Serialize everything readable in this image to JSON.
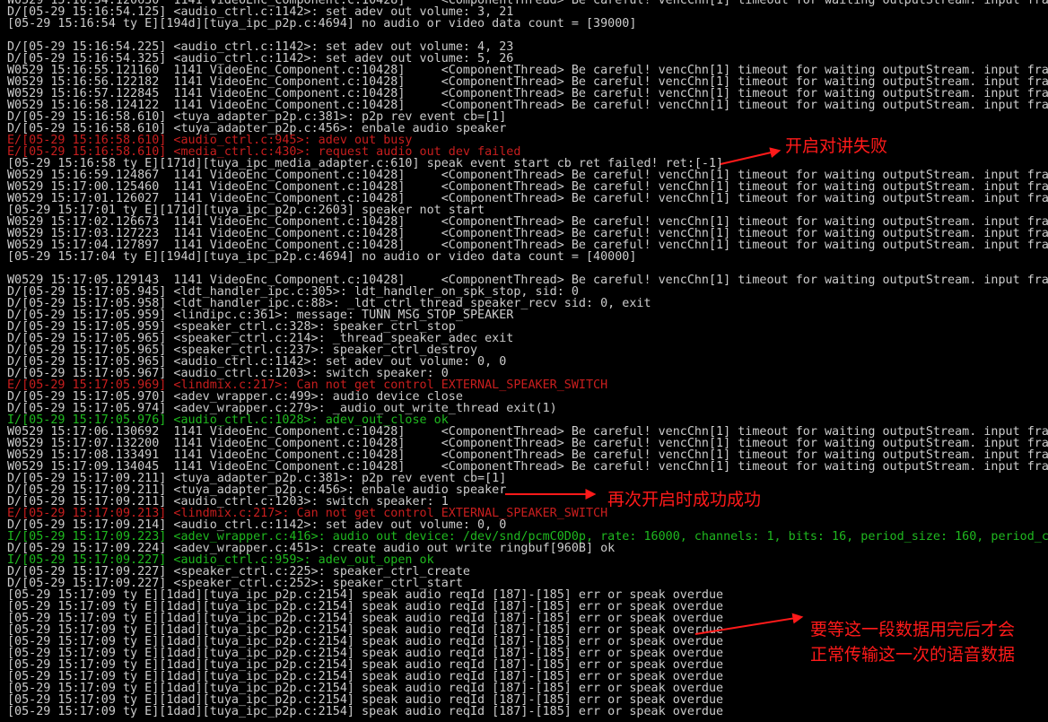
{
  "colors": {
    "background": "#000000",
    "normal_text": "#cccccc",
    "error_text": "#c81e1e",
    "info_text": "#1fb81f",
    "annotation": "#ff1a1a"
  },
  "log_lines": [
    {
      "level": "normal",
      "text": "W0529 15:16:54.120630  1141 VideoEnc_Component.c:10428]     <ComponentThread> Be careful! vencChn[1] timeout for waiting outputStream. input fram"
    },
    {
      "level": "normal",
      "text": "D/[05-29 15:16:54.125] <audio_ctrl.c:1142>: set adev out volume: 3, 21"
    },
    {
      "level": "normal",
      "text": "[05-29 15:16:54 ty E][194d][tuya_ipc_p2p.c:4694] no audio or video data count = [39000]"
    },
    {
      "level": "blank",
      "text": ""
    },
    {
      "level": "normal",
      "text": "D/[05-29 15:16:54.225] <audio_ctrl.c:1142>: set adev out volume: 4, 23"
    },
    {
      "level": "normal",
      "text": "D/[05-29 15:16:54.325] <audio_ctrl.c:1142>: set adev out volume: 5, 26"
    },
    {
      "level": "normal",
      "text": "W0529 15:16:55.121160  1141 VideoEnc_Component.c:10428]     <ComponentThread> Be careful! vencChn[1] timeout for waiting outputStream. input fram"
    },
    {
      "level": "normal",
      "text": "W0529 15:16:56.122182  1141 VideoEnc_Component.c:10428]     <ComponentThread> Be careful! vencChn[1] timeout for waiting outputStream. input fram"
    },
    {
      "level": "normal",
      "text": "W0529 15:16:57.122845  1141 VideoEnc_Component.c:10428]     <ComponentThread> Be careful! vencChn[1] timeout for waiting outputStream. input fram"
    },
    {
      "level": "normal",
      "text": "W0529 15:16:58.124122  1141 VideoEnc_Component.c:10428]     <ComponentThread> Be careful! vencChn[1] timeout for waiting outputStream. input fram"
    },
    {
      "level": "normal",
      "text": "D/[05-29 15:16:58.610] <tuya_adapter_p2p.c:381>: p2p rev event cb=[1]"
    },
    {
      "level": "normal",
      "text": "D/[05-29 15:16:58.610] <tuya_adapter_p2p.c:456>: enbale audio speaker"
    },
    {
      "level": "error",
      "text": "E/[05-29 15:16:58.610] <audio_ctrl.c:945>: adev out busy"
    },
    {
      "level": "error",
      "text": "E/[05-29 15:16:58.610] <media_ctrl.c:430>: request audio out dev failed"
    },
    {
      "level": "normal",
      "text": "[05-29 15:16:58 ty E][171d][tuya_ipc_media_adapter.c:610] speak event start cb ret failed! ret:[-1]"
    },
    {
      "level": "normal",
      "text": "W0529 15:16:59.124867  1141 VideoEnc_Component.c:10428]     <ComponentThread> Be careful! vencChn[1] timeout for waiting outputStream. input fram"
    },
    {
      "level": "normal",
      "text": "W0529 15:17:00.125460  1141 VideoEnc_Component.c:10428]     <ComponentThread> Be careful! vencChn[1] timeout for waiting outputStream. input fram"
    },
    {
      "level": "normal",
      "text": "W0529 15:17:01.126027  1141 VideoEnc_Component.c:10428]     <ComponentThread> Be careful! vencChn[1] timeout for waiting outputStream. input fram"
    },
    {
      "level": "normal",
      "text": "[05-29 15:17:01 ty E][171d][tuya_ipc_p2p.c:2603] speaker not start"
    },
    {
      "level": "normal",
      "text": "W0529 15:17:02.126673  1141 VideoEnc_Component.c:10428]     <ComponentThread> Be careful! vencChn[1] timeout for waiting outputStream. input fram"
    },
    {
      "level": "normal",
      "text": "W0529 15:17:03.127223  1141 VideoEnc_Component.c:10428]     <ComponentThread> Be careful! vencChn[1] timeout for waiting outputStream. input fram"
    },
    {
      "level": "normal",
      "text": "W0529 15:17:04.127897  1141 VideoEnc_Component.c:10428]     <ComponentThread> Be careful! vencChn[1] timeout for waiting outputStream. input fram"
    },
    {
      "level": "normal",
      "text": "[05-29 15:17:04 ty E][194d][tuya_ipc_p2p.c:4694] no audio or video data count = [40000]"
    },
    {
      "level": "blank",
      "text": ""
    },
    {
      "level": "normal",
      "text": "W0529 15:17:05.129143  1141 VideoEnc_Component.c:10428]     <ComponentThread> Be careful! vencChn[1] timeout for waiting outputStream. input fram"
    },
    {
      "level": "normal",
      "text": "D/[05-29 15:17:05.945] <ldt_handler_ipc.c:305>: ldt_handler_on_spk_stop, sid: 0"
    },
    {
      "level": "normal",
      "text": "D/[05-29 15:17:05.958] <ldt_handler_ipc.c:88>: _ldt_ctrl_thread_speaker_recv sid: 0, exit"
    },
    {
      "level": "normal",
      "text": "D/[05-29 15:17:05.959] <lindipc.c:361>: message: TUNN_MSG_STOP_SPEAKER"
    },
    {
      "level": "normal",
      "text": "D/[05-29 15:17:05.959] <speaker_ctrl.c:328>: speaker_ctrl_stop"
    },
    {
      "level": "normal",
      "text": "D/[05-29 15:17:05.965] <speaker_ctrl.c:214>: _thread_speaker_adec exit"
    },
    {
      "level": "normal",
      "text": "D/[05-29 15:17:05.965] <speaker_ctrl.c:237>: speaker_ctrl_destroy"
    },
    {
      "level": "normal",
      "text": "D/[05-29 15:17:05.965] <audio_ctrl.c:1142>: set adev out volume: 0, 0"
    },
    {
      "level": "normal",
      "text": "D/[05-29 15:17:05.967] <audio_ctrl.c:1203>: switch speaker: 0"
    },
    {
      "level": "error",
      "text": "E/[05-29 15:17:05.969] <lindmix.c:217>: Can not get control EXTERNAL_SPEAKER_SWITCH"
    },
    {
      "level": "normal",
      "text": "D/[05-29 15:17:05.970] <adev_wrapper.c:499>: audio device close"
    },
    {
      "level": "normal",
      "text": "D/[05-29 15:17:05.974] <adev_wrapper.c:279>: _audio_out_write_thread exit(1)"
    },
    {
      "level": "info",
      "text": "I/[05-29 15:17:05.976] <audio_ctrl.c:1028>: adev_out_close ok"
    },
    {
      "level": "normal",
      "text": "W0529 15:17:06.130692  1141 VideoEnc_Component.c:10428]     <ComponentThread> Be careful! vencChn[1] timeout for waiting outputStream. input fram"
    },
    {
      "level": "normal",
      "text": "W0529 15:17:07.132200  1141 VideoEnc_Component.c:10428]     <ComponentThread> Be careful! vencChn[1] timeout for waiting outputStream. input fram"
    },
    {
      "level": "normal",
      "text": "W0529 15:17:08.133491  1141 VideoEnc_Component.c:10428]     <ComponentThread> Be careful! vencChn[1] timeout for waiting outputStream. input fram"
    },
    {
      "level": "normal",
      "text": "W0529 15:17:09.134045  1141 VideoEnc_Component.c:10428]     <ComponentThread> Be careful! vencChn[1] timeout for waiting outputStream. input fram"
    },
    {
      "level": "normal",
      "text": "D/[05-29 15:17:09.211] <tuya_adapter_p2p.c:381>: p2p rev event cb=[1]"
    },
    {
      "level": "normal",
      "text": "D/[05-29 15:17:09.211] <tuya_adapter_p2p.c:456>: enbale audio speaker"
    },
    {
      "level": "normal",
      "text": "D/[05-29 15:17:09.211] <audio_ctrl.c:1203>: switch speaker: 1"
    },
    {
      "level": "error",
      "text": "E/[05-29 15:17:09.213] <lindmix.c:217>: Can not get control EXTERNAL_SPEAKER_SWITCH"
    },
    {
      "level": "normal",
      "text": "D/[05-29 15:17:09.214] <audio_ctrl.c:1142>: set adev out volume: 0, 0"
    },
    {
      "level": "info",
      "text": "I/[05-29 15:17:09.223] <adev_wrapper.c:416>: audio out device: /dev/snd/pcmC0D0p, rate: 16000, channels: 1, bits: 16, period_size: 160, period_co"
    },
    {
      "level": "normal",
      "text": "D/[05-29 15:17:09.224] <adev_wrapper.c:451>: create audio out write ringbuf[960B] ok"
    },
    {
      "level": "info",
      "text": "I/[05-29 15:17:09.227] <audio_ctrl.c:959>: adev_out_open ok"
    },
    {
      "level": "normal",
      "text": "D/[05-29 15:17:09.227] <speaker_ctrl.c:225>: speaker_ctrl_create"
    },
    {
      "level": "normal",
      "text": "D/[05-29 15:17:09.227] <speaker_ctrl.c:252>: speaker_ctrl_start"
    },
    {
      "level": "normal",
      "text": "[05-29 15:17:09 ty E][1dad][tuya_ipc_p2p.c:2154] speak audio reqId [187]-[185] err or speak overdue"
    },
    {
      "level": "normal",
      "text": "[05-29 15:17:09 ty E][1dad][tuya_ipc_p2p.c:2154] speak audio reqId [187]-[185] err or speak overdue"
    },
    {
      "level": "normal",
      "text": "[05-29 15:17:09 ty E][1dad][tuya_ipc_p2p.c:2154] speak audio reqId [187]-[185] err or speak overdue"
    },
    {
      "level": "normal",
      "text": "[05-29 15:17:09 ty E][1dad][tuya_ipc_p2p.c:2154] speak audio reqId [187]-[185] err or speak overdue"
    },
    {
      "level": "normal",
      "text": "[05-29 15:17:09 ty E][1dad][tuya_ipc_p2p.c:2154] speak audio reqId [187]-[185] err or speak overdue"
    },
    {
      "level": "normal",
      "text": "[05-29 15:17:09 ty E][1dad][tuya_ipc_p2p.c:2154] speak audio reqId [187]-[185] err or speak overdue"
    },
    {
      "level": "normal",
      "text": "[05-29 15:17:09 ty E][1dad][tuya_ipc_p2p.c:2154] speak audio reqId [187]-[185] err or speak overdue"
    },
    {
      "level": "normal",
      "text": "[05-29 15:17:09 ty E][1dad][tuya_ipc_p2p.c:2154] speak audio reqId [187]-[185] err or speak overdue"
    },
    {
      "level": "normal",
      "text": "[05-29 15:17:09 ty E][1dad][tuya_ipc_p2p.c:2154] speak audio reqId [187]-[185] err or speak overdue"
    },
    {
      "level": "normal",
      "text": "[05-29 15:17:09 ty E][1dad][tuya_ipc_p2p.c:2154] speak audio reqId [187]-[185] err or speak overdue"
    },
    {
      "level": "normal",
      "text": "[05-29 15:17:09 ty E][1dad][tuya_ipc_p2p.c:2154] speak audio reqId [187]-[185] err or speak overdue"
    }
  ],
  "annotations": {
    "talk_failed": "开启对讲失败",
    "reopen_success": "再次开启时成功成功",
    "wait_note_line1": "要等这一段数据用完后才会",
    "wait_note_line2": "正常传输这一次的语音数据"
  }
}
